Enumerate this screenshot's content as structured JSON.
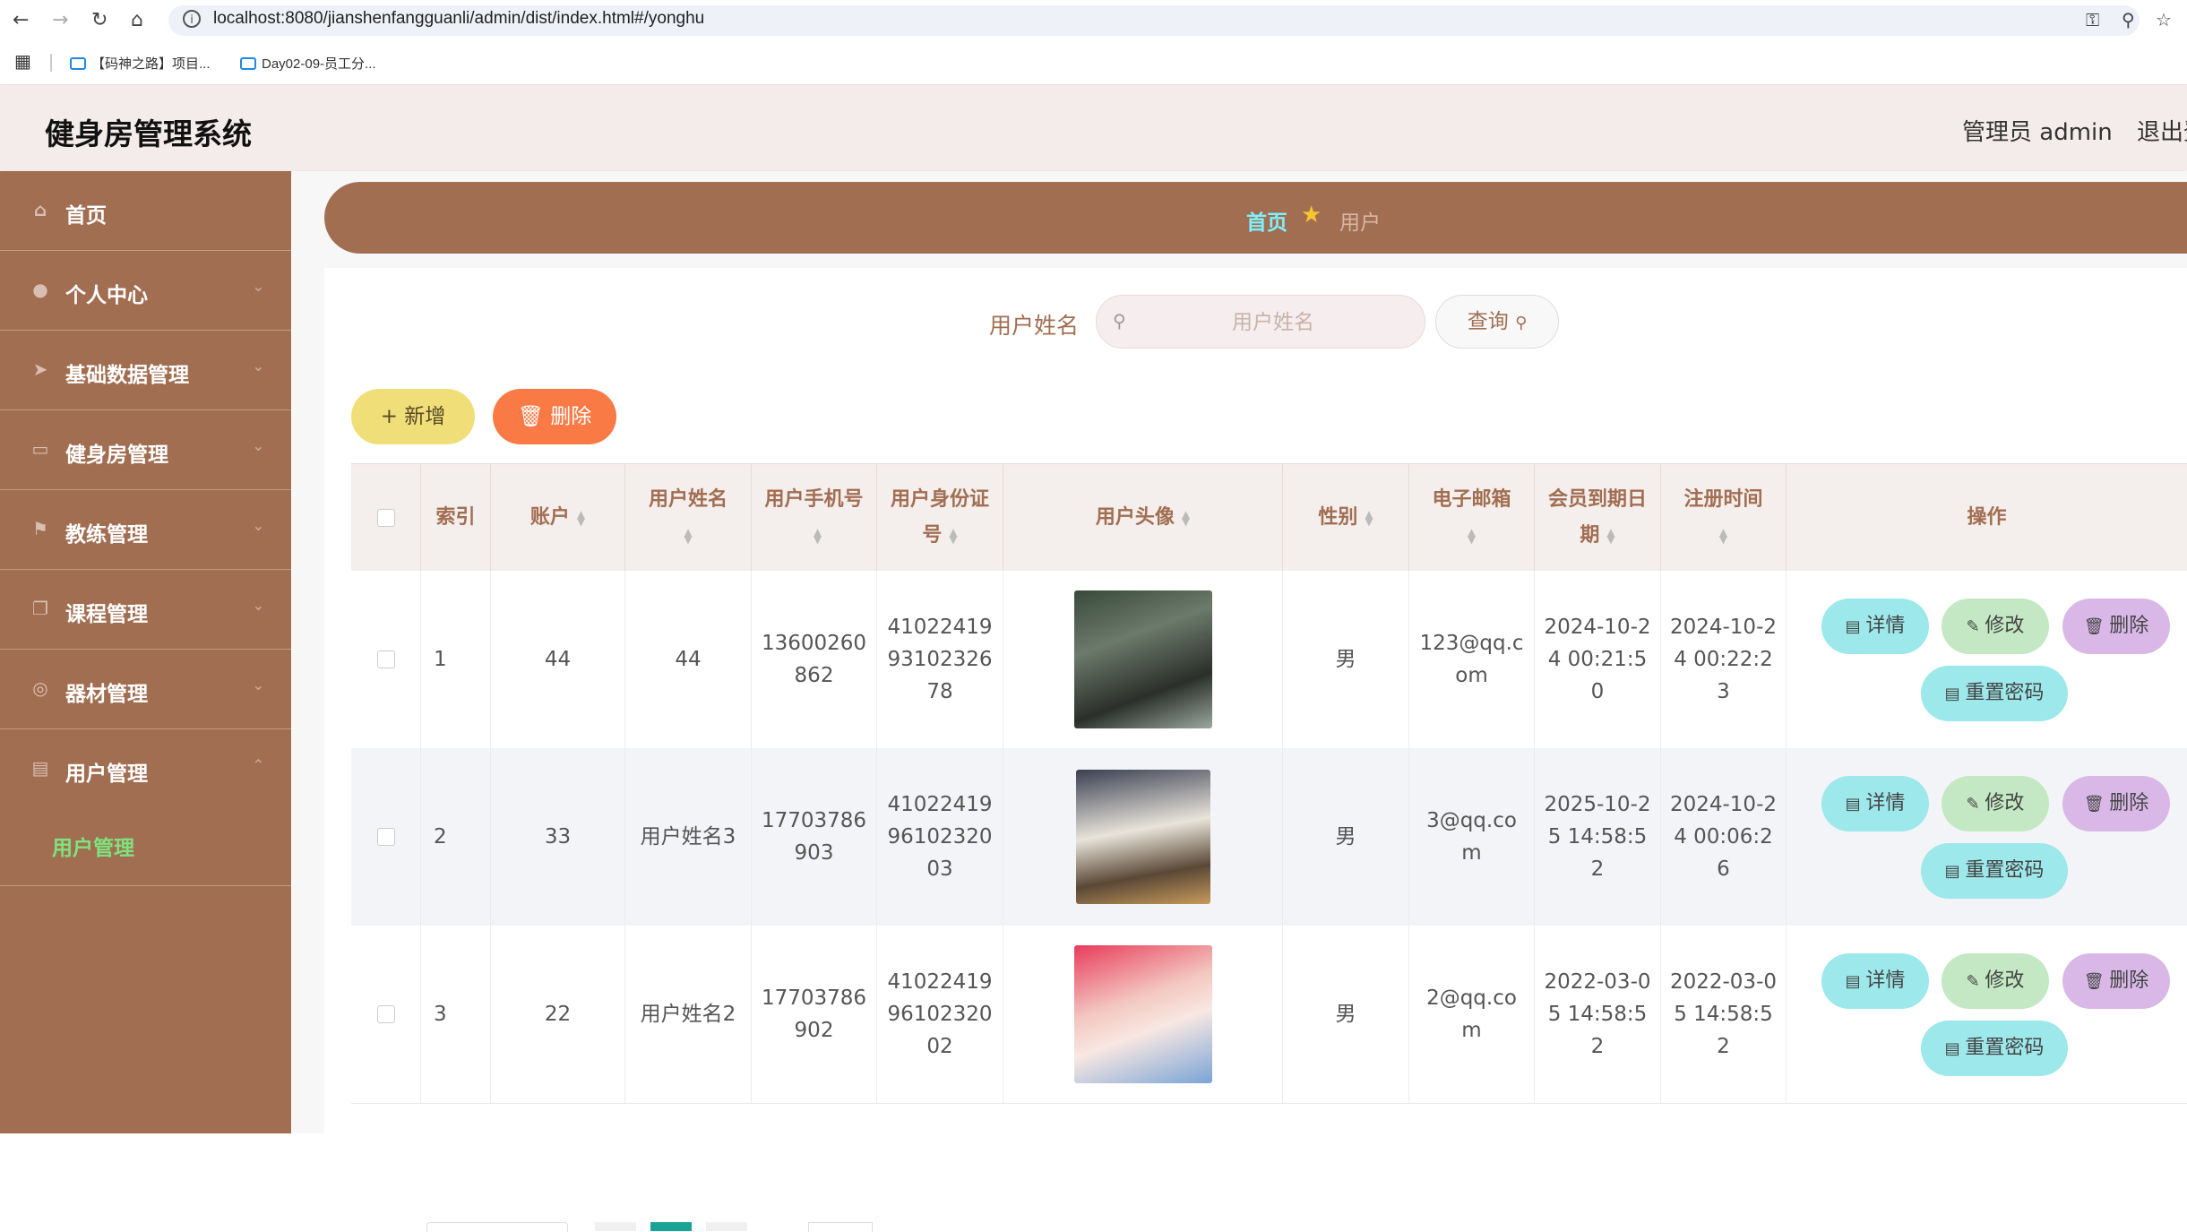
{
  "browser": {
    "url": "localhost:8080/jianshenfangguanli/admin/dist/index.html#/yonghu",
    "bookmarks": [
      {
        "label": "【码神之路】项目..."
      },
      {
        "label": "Day02-09-员工分..."
      }
    ]
  },
  "header": {
    "title": "健身房管理系统",
    "admin": "管理员 admin",
    "logout": "退出登录"
  },
  "sidebar": {
    "items": [
      {
        "label": "首页",
        "icon": "home-icon"
      },
      {
        "label": "个人中心",
        "icon": "user-icon"
      },
      {
        "label": "基础数据管理",
        "icon": "send-icon"
      },
      {
        "label": "健身房管理",
        "icon": "monitor-icon"
      },
      {
        "label": "教练管理",
        "icon": "flag-icon"
      },
      {
        "label": "课程管理",
        "icon": "copy-icon"
      },
      {
        "label": "器材管理",
        "icon": "compass-icon"
      },
      {
        "label": "用户管理",
        "icon": "clipboard-icon"
      }
    ],
    "sub_item": "用户管理"
  },
  "breadcrumb": {
    "home": "首页",
    "current": "用户"
  },
  "search": {
    "label": "用户姓名",
    "placeholder": "用户姓名",
    "button": "查询"
  },
  "actions": {
    "add": "新增",
    "delete": "删除"
  },
  "table": {
    "headers": [
      "索引",
      "账户",
      "用户姓名",
      "用户手机号",
      "用户身份证号",
      "用户头像",
      "性别",
      "电子邮箱",
      "会员到期日期",
      "注册时间",
      "操作"
    ],
    "op_labels": {
      "detail": "详情",
      "edit": "修改",
      "delete": "删除",
      "reset": "重置密码"
    },
    "rows": [
      {
        "index": "1",
        "account": "44",
        "name": "44",
        "phone": "13600260862",
        "idcard": "410224199310232678",
        "gender": "男",
        "email": "123@qq.com",
        "expire": "2024-10-24 00:21:50",
        "register": "2024-10-24 00:22:23"
      },
      {
        "index": "2",
        "account": "33",
        "name": "用户姓名3",
        "phone": "17703786903",
        "idcard": "410224199610232003",
        "gender": "男",
        "email": "3@qq.com",
        "expire": "2025-10-25 14:58:52",
        "register": "2024-10-24 00:06:26"
      },
      {
        "index": "3",
        "account": "22",
        "name": "用户姓名2",
        "phone": "17703786902",
        "idcard": "410224199610232002",
        "gender": "男",
        "email": "2@qq.com",
        "expire": "2022-03-05 14:58:52",
        "register": "2022-03-05 14:58:52"
      }
    ]
  },
  "colors": {
    "brand": "#a26e52",
    "header_bg": "#f4ecea",
    "active_sub": "#7ee27e"
  }
}
